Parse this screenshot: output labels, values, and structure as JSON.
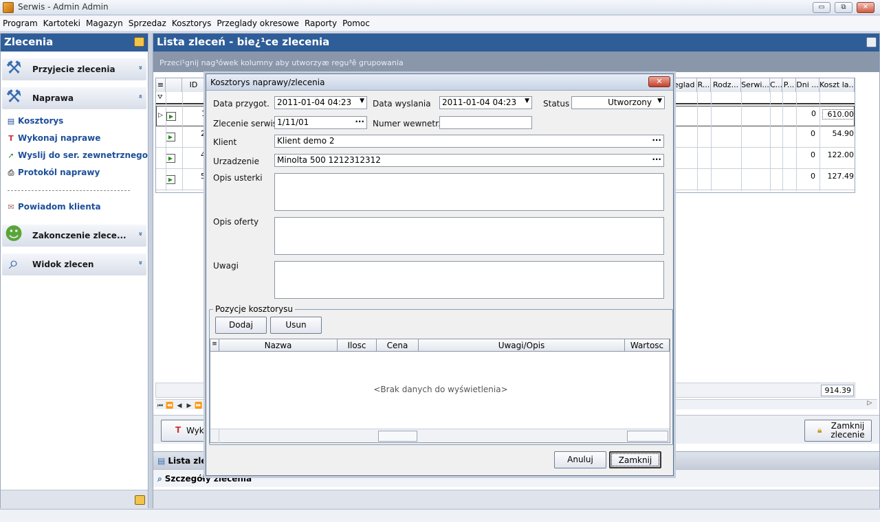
{
  "window": {
    "title": "Serwis -  Admin Admin",
    "minimize": "▭",
    "restore": "⧉",
    "close": "✕"
  },
  "menu": [
    "Program",
    "Kartoteki",
    "Magazyn",
    "Sprzedaz",
    "Kosztorys",
    "Przeglady okresowe",
    "Raporty",
    "Pomoc"
  ],
  "left_panel": {
    "title": "Zlecenia",
    "groups": [
      {
        "label": "Przyjecie zlecenia",
        "chevron": "»"
      },
      {
        "label": "Naprawa",
        "chevron": "«"
      },
      {
        "label": "Zakonczenie zlece...",
        "chevron": "»"
      },
      {
        "label": "Widok zlecen",
        "chevron": "»"
      }
    ],
    "naprawa_items": [
      "Kosztorys",
      "Wykonaj naprawe",
      "Wyslij do ser. zewnetrznego",
      "Protokól naprawy"
    ],
    "notify_item": "Powiadom klienta"
  },
  "main": {
    "title": "Lista zleceń - bie¿¹ce zlecenia",
    "grouping_hint": "Przeci¹gnij nag³ówek kolumny aby utworzyæ regu³ê grupowania",
    "columns": [
      "ID",
      "eglad",
      "R...",
      "Rodz...",
      "Serwi...",
      "C...",
      "P...",
      "Dni ...",
      "Koszt la..."
    ],
    "rows": [
      {
        "id": "1",
        "dni": "0",
        "koszt": "610.00"
      },
      {
        "id": "2",
        "dni": "0",
        "koszt": "54.90"
      },
      {
        "id": "4",
        "dni": "0",
        "koszt": "122.00"
      },
      {
        "id": "5",
        "dni": "0",
        "koszt": "127.49"
      }
    ],
    "total": "914.39",
    "buttons": {
      "wykonaj": "Wyk",
      "zamknij": "Zamknij zlecenie"
    },
    "tabs": [
      "Lista zlec",
      "Szczegóły zlecenia"
    ]
  },
  "dialog": {
    "title": "Kosztorys naprawy/zlecenia",
    "labels": {
      "data_przygot": "Data przygot.",
      "data_wyslania": "Data wyslania",
      "status": "Status",
      "zlecenie": "Zlecenie serwis.",
      "numer": "Numer wewnetrzny",
      "klient": "Klient",
      "urzadzenie": "Urzadzenie",
      "opis_usterki": "Opis usterki",
      "opis_oferty": "Opis oferty",
      "uwagi": "Uwagi"
    },
    "values": {
      "data_przygot": "2011-01-04 04:23",
      "data_wyslania": "2011-01-04 04:23",
      "status": "Utworzony",
      "zlecenie": "1/11/01",
      "numer": "",
      "klient": "Klient demo 2",
      "urzadzenie": "Minolta 500 1212312312"
    },
    "positions": {
      "legend": "Pozycje kosztorysu",
      "add": "Dodaj",
      "remove": "Usun",
      "columns": [
        "Nazwa",
        "Ilosc",
        "Cena",
        "Uwagi/Opis",
        "Wartosc"
      ],
      "empty": "<Brak danych do wyświetlenia>"
    },
    "buttons": {
      "cancel": "Anuluj",
      "close": "Zamknij"
    }
  }
}
